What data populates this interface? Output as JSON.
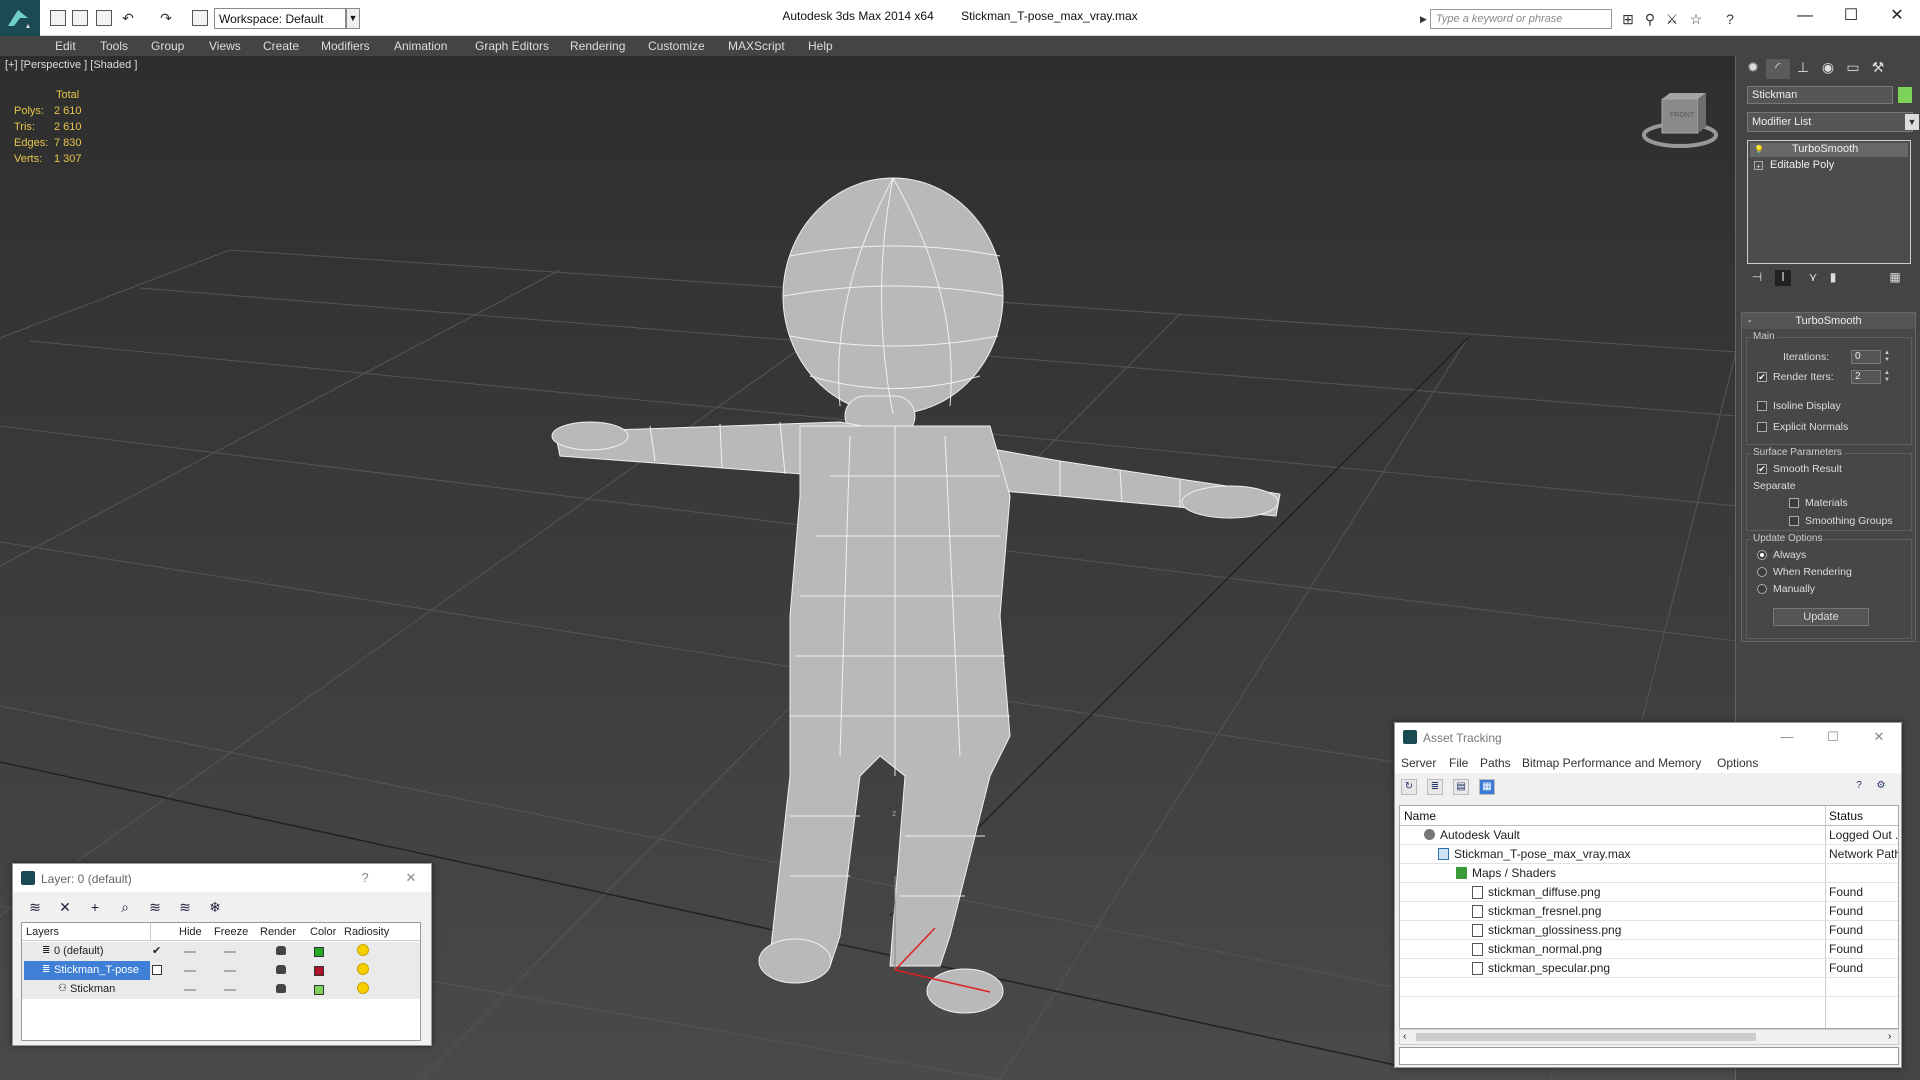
{
  "titlebar": {
    "app_name": "Autodesk 3ds Max  2014 x64",
    "file_name": "Stickman_T-pose_max_vray.max",
    "workspace": "Workspace: Default",
    "search_placeholder": "Type a keyword or phrase"
  },
  "menu": [
    "Edit",
    "Tools",
    "Group",
    "Views",
    "Create",
    "Modifiers",
    "Animation",
    "Graph Editors",
    "Rendering",
    "Customize",
    "MAXScript",
    "Help"
  ],
  "viewport": {
    "label": "[+] [Perspective ] [Shaded ]",
    "stats_header": "Total",
    "stats": [
      {
        "label": "Polys:",
        "value": "2 610"
      },
      {
        "label": "Tris:",
        "value": "2 610"
      },
      {
        "label": "Edges:",
        "value": "7 830"
      },
      {
        "label": "Verts:",
        "value": "1 307"
      }
    ],
    "viewcube_label": "FRONT",
    "axis_label": "z"
  },
  "command_panel": {
    "object_name": "Stickman",
    "object_color": "#7dd35a",
    "modifier_list": "Modifier List",
    "stack": [
      "TurboSmooth",
      "Editable Poly"
    ],
    "rollout_title": "TurboSmooth",
    "main": {
      "title": "Main",
      "iterations_label": "Iterations:",
      "iterations_value": "0",
      "render_iters_label": "Render Iters:",
      "render_iters_value": "2",
      "render_iters_checked": true,
      "isoline_label": "Isoline Display",
      "isoline_checked": false,
      "explicit_normals_label": "Explicit Normals",
      "explicit_normals_checked": false
    },
    "surface": {
      "title": "Surface Parameters",
      "smooth_result_label": "Smooth Result",
      "smooth_result_checked": true,
      "separate_label": "Separate",
      "materials_label": "Materials",
      "smoothing_groups_label": "Smoothing Groups"
    },
    "update_options": {
      "title": "Update Options",
      "always": "Always",
      "when_rendering": "When Rendering",
      "manually": "Manually",
      "update_button": "Update",
      "selected": "Always"
    }
  },
  "asset_tracking": {
    "title": "Asset Tracking",
    "menu": [
      "Server",
      "File",
      "Paths",
      "Bitmap Performance and Memory",
      "Options"
    ],
    "columns": [
      "Name",
      "Status"
    ],
    "rows": [
      {
        "name": "Autodesk Vault",
        "status": "Logged Out ...",
        "level": 0
      },
      {
        "name": "Stickman_T-pose_max_vray.max",
        "status": "Network Path",
        "level": 1
      },
      {
        "name": "Maps / Shaders",
        "status": "",
        "level": 2
      },
      {
        "name": "stickman_diffuse.png",
        "status": "Found",
        "level": 3
      },
      {
        "name": "stickman_fresnel.png",
        "status": "Found",
        "level": 3
      },
      {
        "name": "stickman_glossiness.png",
        "status": "Found",
        "level": 3
      },
      {
        "name": "stickman_normal.png",
        "status": "Found",
        "level": 3
      },
      {
        "name": "stickman_specular.png",
        "status": "Found",
        "level": 3
      }
    ]
  },
  "layer_window": {
    "title": "Layer: 0 (default)",
    "help": "?",
    "columns": [
      "Layers",
      "Hide",
      "Freeze",
      "Render",
      "Color",
      "Radiosity"
    ],
    "rows": [
      {
        "name": "0 (default)",
        "color": "#22aa22",
        "active": true
      },
      {
        "name": "Stickman_T-pose",
        "color": "#b0102a",
        "selected": true
      },
      {
        "name": "Stickman",
        "color": "#7dd35a"
      }
    ]
  }
}
